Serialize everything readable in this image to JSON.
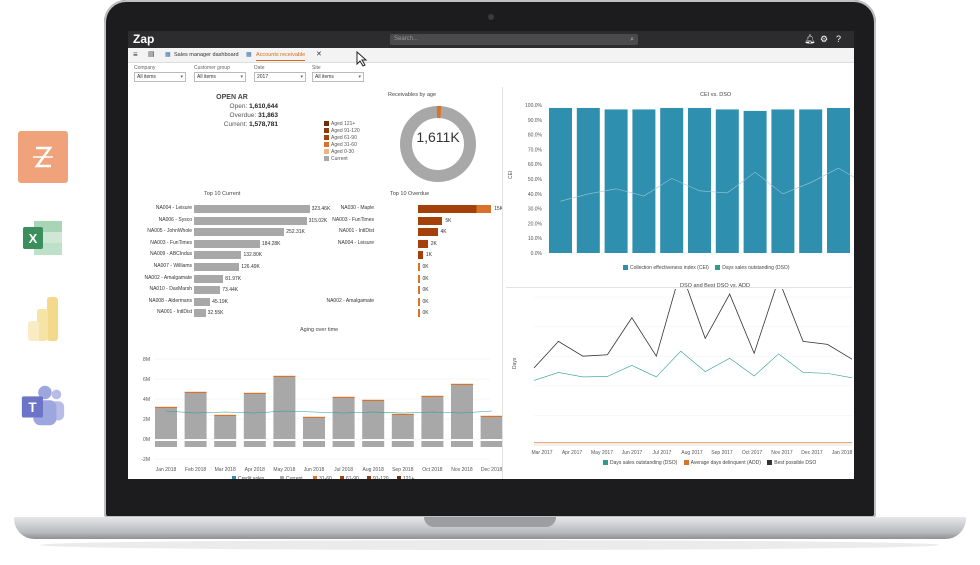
{
  "colors": {
    "teal": "#2e8fae",
    "gray": "#a8a8a8",
    "orange": "#d9722a",
    "dark_orange": "#a4410b",
    "brown": "#6b2d0a",
    "accent": "#e06a10"
  },
  "side_apps": [
    {
      "name": "zap",
      "icon": "zap-logo-icon"
    },
    {
      "name": "excel",
      "icon": "excel-logo-icon",
      "letter": "X"
    },
    {
      "name": "power-bi",
      "icon": "power-bi-logo-icon"
    },
    {
      "name": "teams",
      "icon": "teams-logo-icon",
      "letter": "T"
    }
  ],
  "app": {
    "logo": "Zap",
    "search_placeholder": "Search...",
    "icons": [
      "bell-icon",
      "gear-icon",
      "help-icon"
    ]
  },
  "tabs": [
    {
      "label": "Sales manager dashboard",
      "active": false
    },
    {
      "label": "Accounts receivable",
      "active": true
    }
  ],
  "filters": [
    {
      "label": "Company",
      "value": "All items"
    },
    {
      "label": "Customer group",
      "value": "All items"
    },
    {
      "label": "Date",
      "value": "2017"
    },
    {
      "label": "Site",
      "value": "All items"
    }
  ],
  "open_ar": {
    "title": "OPEN AR",
    "open_label": "Open:",
    "open_value": "1,610,644",
    "overdue_label": "Overdue:",
    "overdue_value": "31,863",
    "current_label": "Current:",
    "current_value": "1,578,781"
  },
  "receivables_by_age": {
    "title": "Receivables by age",
    "total": "1,611K",
    "legend": [
      {
        "label": "Aged 121+",
        "color": "#6b2d0a"
      },
      {
        "label": "Aged 91-120",
        "color": "#8c3a0e"
      },
      {
        "label": "Aged 61-90",
        "color": "#a4410b"
      },
      {
        "label": "Aged 31-60",
        "color": "#d9722a"
      },
      {
        "label": "Aged 0-30",
        "color": "#f0b183"
      },
      {
        "label": "Current",
        "color": "#a8a8a8"
      }
    ],
    "current_share": 0.98
  },
  "top10_current": {
    "title": "Top 10 Current",
    "rows": [
      {
        "label": "NA004 - Leisure",
        "value": 323.46,
        "text": "323.46K"
      },
      {
        "label": "NA006 - Sysco",
        "value": 315.02,
        "text": "315.02K"
      },
      {
        "label": "NA005 - JohnWhole",
        "value": 252.31,
        "text": "252.31K"
      },
      {
        "label": "NA003 - FunTimes",
        "value": 184.28,
        "text": "184.28K"
      },
      {
        "label": "NA009 - ABCIndus",
        "value": 132.8,
        "text": "132.80K"
      },
      {
        "label": "NA007 - Williams",
        "value": 126.49,
        "text": "126.49K"
      },
      {
        "label": "NA002 - Amalgamate",
        "value": 81.97,
        "text": "81.97K"
      },
      {
        "label": "NA010 - DaxMarsh",
        "value": 73.44,
        "text": "73.44K"
      },
      {
        "label": "NA008 - Aldermans",
        "value": 45.19,
        "text": "45.19K"
      },
      {
        "label": "NA001 - IntlDist",
        "value": 32.55,
        "text": "32.55K"
      }
    ]
  },
  "top10_overdue": {
    "title": "Top 10 Overdue",
    "rows": [
      {
        "label": "NA030 - Maple",
        "value": 15,
        "text": "15K"
      },
      {
        "label": "NA003 - FunTimes",
        "value": 5,
        "text": "5K"
      },
      {
        "label": "NA001 - IntlDist",
        "value": 4,
        "text": "4K"
      },
      {
        "label": "NA004 - Leisure",
        "value": 2,
        "text": "2K"
      },
      {
        "label": "",
        "value": 1,
        "text": "1K"
      },
      {
        "label": "",
        "value": 0,
        "text": "0K"
      },
      {
        "label": "",
        "value": 0,
        "text": "0K"
      },
      {
        "label": "",
        "value": 0,
        "text": "0K"
      },
      {
        "label": "NA002 - Amalgamate",
        "value": 0,
        "text": "0K"
      },
      {
        "label": "",
        "value": 0,
        "text": "0K"
      }
    ]
  },
  "aging_over_time": {
    "title": "Aging over time",
    "y_ticks": [
      "8M",
      "6M",
      "4M",
      "2M",
      "0M",
      "-2M"
    ],
    "months": [
      "Jan 2018",
      "Feb 2018",
      "Mar 2018",
      "Apr 2018",
      "May 2018",
      "Jun 2018",
      "Jul 2018",
      "Aug 2018",
      "Sep 2018",
      "Oct 2018",
      "Nov 2018",
      "Dec 2018"
    ],
    "stack": [
      3.1,
      4.6,
      2.3,
      4.5,
      6.2,
      2.1,
      4.1,
      3.8,
      2.4,
      4.2,
      5.4,
      2.2
    ],
    "line": [
      2.8,
      2.6,
      2.7,
      2.6,
      2.8,
      2.7,
      2.6,
      2.7,
      2.6,
      2.7,
      2.6,
      2.8
    ],
    "legend": [
      {
        "label": "Credit sales",
        "color": "#2e8fae"
      },
      {
        "label": "Current",
        "color": "#a8a8a8"
      },
      {
        "label": "31-60",
        "color": "#d9722a"
      },
      {
        "label": "61-90",
        "color": "#a4410b"
      },
      {
        "label": "91-120",
        "color": "#8c3a0e"
      },
      {
        "label": "121+",
        "color": "#6b2d0a"
      }
    ]
  },
  "cei_vs_dso": {
    "title": "CEI vs. DSO",
    "y_label": "CEI",
    "y_ticks": [
      "100.0%",
      "90.0%",
      "80.0%",
      "70.0%",
      "60.0%",
      "50.0%",
      "40.0%",
      "30.0%",
      "20.0%",
      "10.0%",
      "0.0%"
    ],
    "bars": [
      98,
      98,
      97,
      97,
      98,
      98,
      97,
      96,
      97,
      97,
      98,
      93
    ],
    "line": [
      50,
      57,
      62,
      55,
      72,
      60,
      58,
      78,
      57,
      68,
      82,
      66
    ],
    "legend": [
      {
        "label": "Collection effectiveness index (CEI)",
        "color": "#2e8fae"
      },
      {
        "label": "Days sales outstanding (DSO)",
        "color": "#2a9d8f"
      }
    ]
  },
  "dso_vs_add": {
    "title": "DSO and Best DSO vs. ADD",
    "y_label": "Days",
    "x_ticks": [
      "Mar 2017",
      "Apr 2017",
      "May 2017",
      "Jun 2017",
      "Jul 2017",
      "Aug 2017",
      "Sep 2017",
      "Oct 2017",
      "Nov 2017",
      "Dec 2017",
      "Jan 2018"
    ],
    "dso": [
      12,
      30,
      20,
      21,
      46,
      20,
      78,
      32,
      62,
      22,
      72,
      30,
      28,
      18
    ],
    "legend": [
      {
        "label": "Days sales outstanding (DSO)",
        "color": "#2a9d8f"
      },
      {
        "label": "Average days delinquent (ADD)",
        "color": "#d9722a"
      },
      {
        "label": "Best possible DSO",
        "color": "#333333"
      }
    ]
  }
}
